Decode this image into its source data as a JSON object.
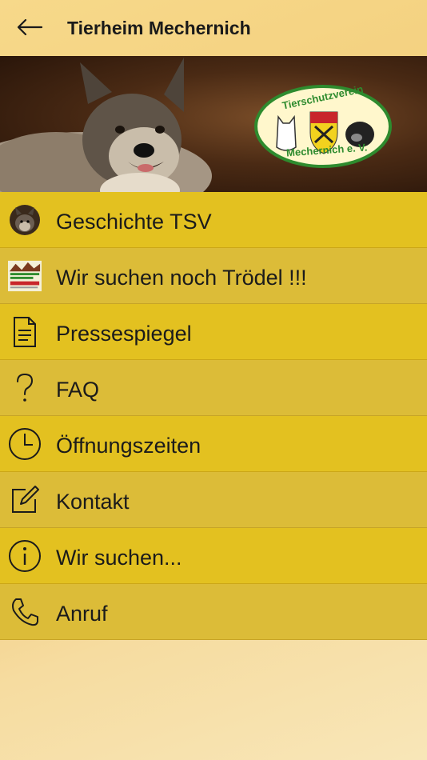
{
  "header": {
    "back_icon": "arrow-left-icon",
    "title": "Tierheim Mechernich"
  },
  "banner": {
    "logo_top_text": "Tierschutzverein",
    "logo_bottom_text": "Mechernich e. V.",
    "logo_color": "#2e8b2e"
  },
  "menu": {
    "items": [
      {
        "icon": "dog-photo-thumbnail",
        "label": "Geschichte TSV"
      },
      {
        "icon": "troedelmarkt-thumbnail",
        "label": "Wir suchen noch Trödel !!!"
      },
      {
        "icon": "document-icon",
        "label": "Pressespiegel"
      },
      {
        "icon": "question-mark-icon",
        "label": "FAQ"
      },
      {
        "icon": "clock-icon",
        "label": "Öffnungszeiten"
      },
      {
        "icon": "edit-icon",
        "label": "Kontakt"
      },
      {
        "icon": "info-icon",
        "label": "Wir suchen..."
      },
      {
        "icon": "phone-icon",
        "label": "Anruf"
      }
    ]
  },
  "colors": {
    "row_primary": "#e3c120",
    "row_alt": "#dcbc38",
    "text": "#1b1b1b"
  }
}
